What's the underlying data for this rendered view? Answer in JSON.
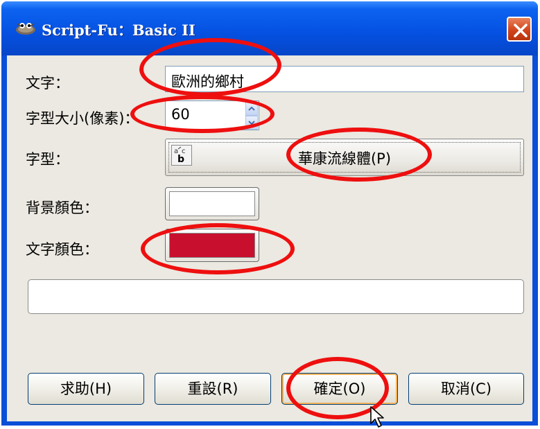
{
  "window": {
    "title": "Script-Fu：Basic II",
    "app_icon": "gimp-wilber-icon",
    "close_icon": "close-x-icon",
    "title_bar_color": "#0a55e6",
    "close_color": "#d1441c"
  },
  "form": {
    "text_label": "文字：",
    "text_value": "歐洲的鄉村",
    "size_label": "字型大小(像素)：",
    "size_value": "60",
    "font_label": "字型：",
    "font_icon": "font-abc-icon",
    "font_value": "華康流線體(P)",
    "bg_color_label": "背景顏色：",
    "bg_color": "#ffffff",
    "text_color_label": "文字顏色：",
    "text_color": "#c8102e"
  },
  "buttons": {
    "help": "求助(H)",
    "reset": "重設(R)",
    "ok": "確定(O)",
    "cancel": "取消(C)"
  },
  "annotation_color": "#ee0f0f"
}
